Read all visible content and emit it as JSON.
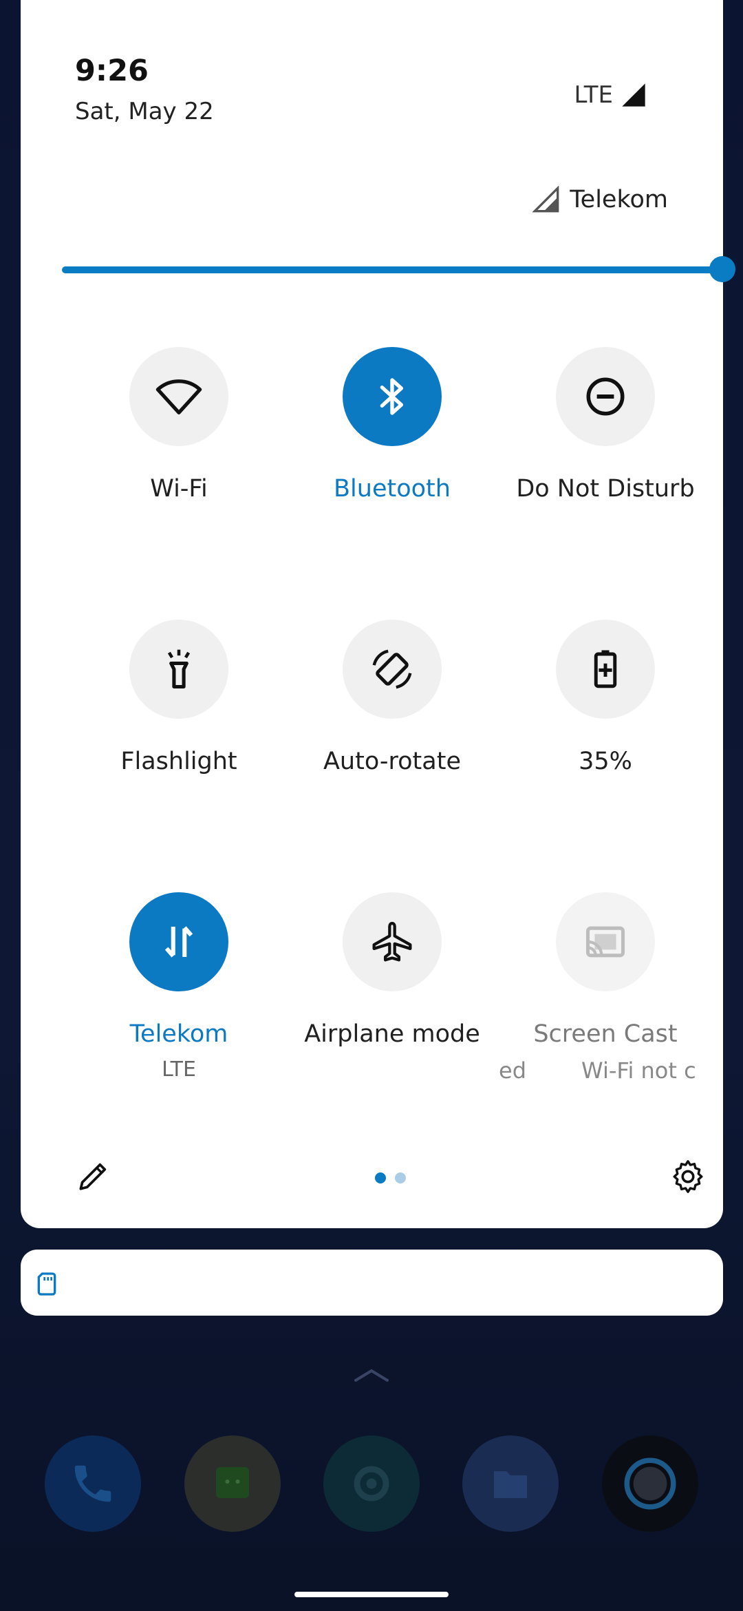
{
  "header": {
    "time": "9:26",
    "date": "Sat, May 22",
    "network_type": "LTE",
    "carrier": "Telekom"
  },
  "brightness": {
    "level_percent": 100
  },
  "tiles": [
    {
      "label": "Wi-Fi",
      "state": "off",
      "icon": "wifi-icon"
    },
    {
      "label": "Bluetooth",
      "state": "on",
      "icon": "bluetooth-icon"
    },
    {
      "label": "Do Not Disturb",
      "state": "off",
      "icon": "do-not-disturb-icon"
    },
    {
      "label": "Flashlight",
      "state": "off",
      "icon": "flashlight-icon"
    },
    {
      "label": "Auto-rotate",
      "state": "off",
      "icon": "auto-rotate-icon"
    },
    {
      "label": "35%",
      "state": "off",
      "icon": "battery-saver-icon"
    },
    {
      "label": "Telekom",
      "sublabel": "LTE",
      "state": "on",
      "icon": "mobile-data-icon"
    },
    {
      "label": "Airplane mode",
      "state": "off",
      "icon": "airplane-icon"
    },
    {
      "label": "Screen Cast",
      "state": "unavailable",
      "icon": "cast-icon",
      "sublabel_left": "ed",
      "sublabel_right": "Wi-Fi not c"
    }
  ],
  "footer": {
    "page_count": 2,
    "current_page": 1,
    "edit_icon": "pencil-icon",
    "settings_icon": "gear-icon"
  },
  "colors": {
    "accent": "#0b7ac2",
    "tile_off": "#f0f0f0",
    "panel_bg": "#ffffff",
    "wallpaper": "#0d1631"
  },
  "dock_apps": [
    "phone-icon",
    "messages-icon",
    "settings-app-icon",
    "files-icon",
    "browser-icon"
  ]
}
